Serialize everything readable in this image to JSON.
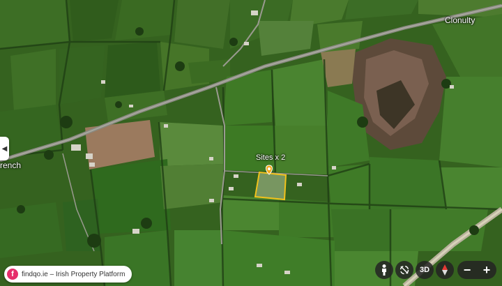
{
  "map": {
    "type": "satellite",
    "place_labels": {
      "clonulty": "Clonulty",
      "west": "rench"
    },
    "site_label": "Sites x 2",
    "site_outline_color": "#f2c21b",
    "pin_color": "#f2a81b"
  },
  "badge": {
    "logo_glyph": "f",
    "text": "findqo.ie – Irish Property Platform"
  },
  "controls": {
    "street_view_icon": "pegman-icon",
    "rotate_icon": "rotate-icon",
    "view_3d": "3D",
    "compass_icon": "compass-icon",
    "zoom_out": "−",
    "zoom_in": "+"
  },
  "collapse_tab": {
    "icon": "chevron-left-icon",
    "glyph": "◀"
  }
}
